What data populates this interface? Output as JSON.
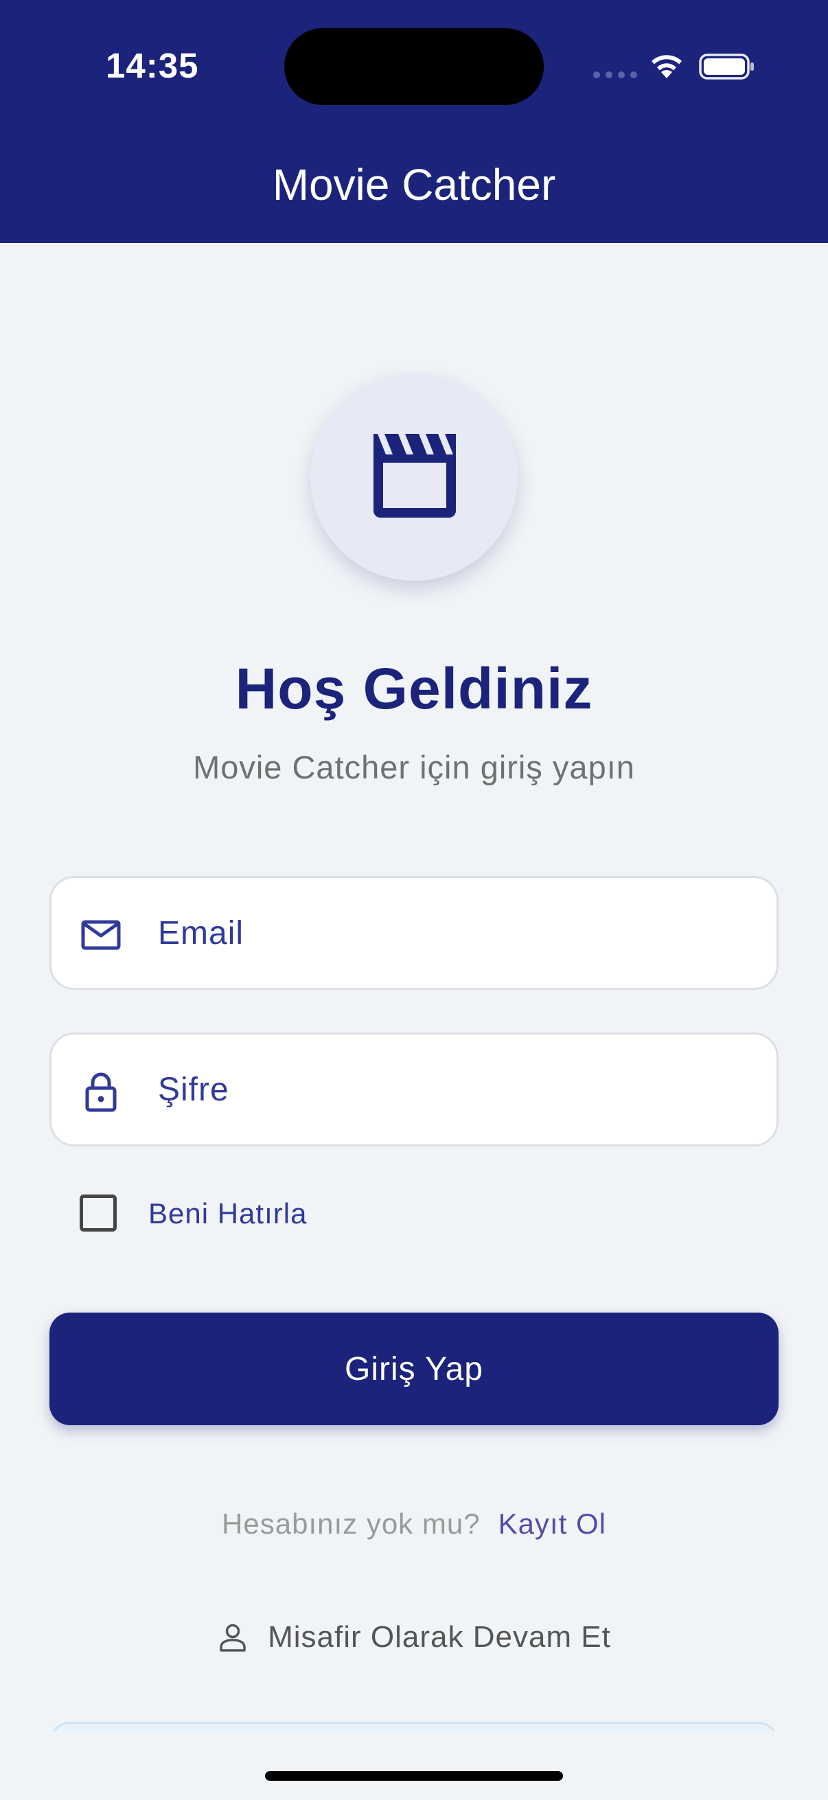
{
  "status_bar": {
    "time": "14:35",
    "icons": [
      "cellular-dots-icon",
      "wifi-icon",
      "battery-icon"
    ]
  },
  "app_bar": {
    "title": "Movie Catcher"
  },
  "logo": {
    "icon": "clapperboard-icon"
  },
  "welcome": {
    "title": "Hoş Geldiniz",
    "subtitle": "Movie Catcher için giriş yapın"
  },
  "form": {
    "email": {
      "placeholder": "Email",
      "value": "",
      "icon": "mail-icon"
    },
    "password": {
      "placeholder": "Şifre",
      "value": "",
      "icon": "lock-icon"
    },
    "remember_me": {
      "label": "Beni Hatırla",
      "checked": false
    },
    "login_button": "Giriş Yap"
  },
  "register": {
    "prompt": "Hesabınız yok mu?",
    "link": "Kayıt Ol"
  },
  "guest": {
    "label": "Misafir Olarak Devam Et",
    "icon": "person-outline-icon"
  },
  "colors": {
    "primary": "#1b237b",
    "accent_text": "#303a9a",
    "link": "#5a4aa8",
    "background": "#f1f4f6"
  }
}
